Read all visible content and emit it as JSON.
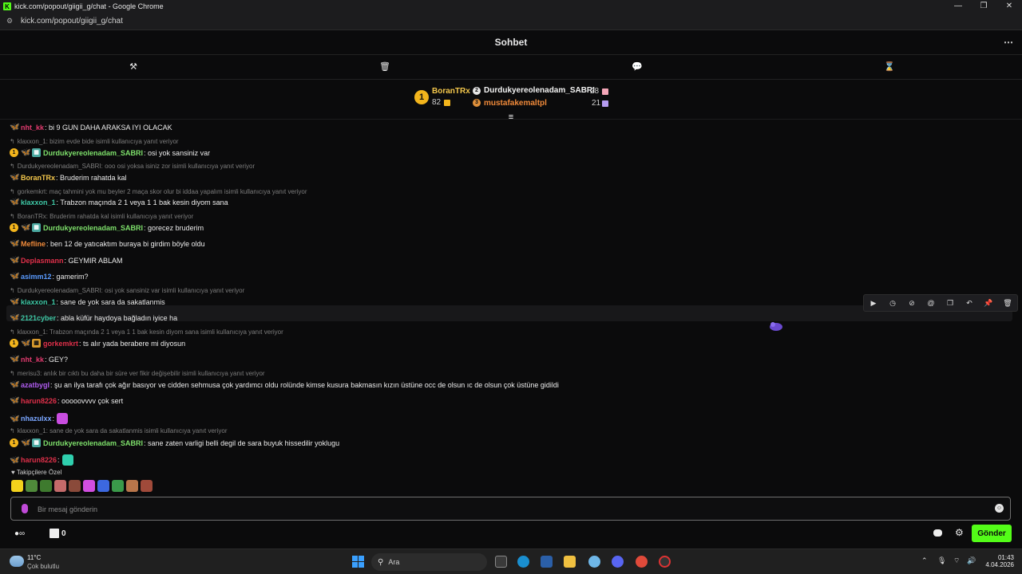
{
  "window": {
    "title": "kick.com/popout/giigii_g/chat - Google Chrome",
    "url": "kick.com/popout/giigii_g/chat",
    "controls": [
      "—",
      "❐",
      "✕"
    ]
  },
  "chat": {
    "title": "Sohbet",
    "more_icon": "⋯"
  },
  "toolbar": {
    "icons": [
      "hammer-icon",
      "trash-icon",
      "chat-bubble-icon",
      "hourglass-icon"
    ]
  },
  "leaderboard": {
    "first": {
      "rank": "1",
      "name": "BoranTRx",
      "count": "82"
    },
    "second": {
      "name": "Durdukyereolenadam_SABRI",
      "count": "28"
    },
    "third": {
      "name": "mustafakemaltpl",
      "count": "21"
    }
  },
  "messages": [
    {
      "type": "msg",
      "user": "nht_kk",
      "color": "#e03a6e",
      "text": ": bi 9 GUN DAHA ARAKSA IYI OLACAK",
      "badges": [
        "fly"
      ]
    },
    {
      "type": "reply",
      "text": "klaxxon_1: bizim evde bide isimli kullanıcıya yanıt veriyor"
    },
    {
      "type": "msg",
      "user": "Durdukyereolenadam_SABRI",
      "color": "#7ee06b",
      "text": ": osi yok sansiniz var",
      "badges": [
        "num",
        "fly",
        "sub"
      ]
    },
    {
      "type": "reply",
      "text": "Durdukyereolenadam_SABRI: ooo osi yoksa isiniz zor isimli kullanıcıya yanıt veriyor"
    },
    {
      "type": "msg",
      "user": "BoranTRx",
      "color": "#f5c84c",
      "text": ": Bruderim rahatda kal",
      "badges": [
        "fly"
      ]
    },
    {
      "type": "reply",
      "text": "gorkemkrt: maç tahmini yok mu beyler 2 maça skor olur bi iddaa yapalım isimli kullanıcıya yanıt veriyor"
    },
    {
      "type": "msg",
      "user": "klaxxon_1",
      "color": "#3ec7a5",
      "text": ": Trabzon maçında 2 1 veya 1 1 bak kesin diyom sana",
      "badges": [
        "fly"
      ]
    },
    {
      "type": "reply",
      "text": "BoranTRx: Bruderim rahatda kal isimli kullanıcıya yanıt veriyor"
    },
    {
      "type": "msg",
      "user": "Durdukyereolenadam_SABRI",
      "color": "#7ee06b",
      "text": ": gorecez bruderim",
      "badges": [
        "num",
        "fly",
        "sub"
      ]
    },
    {
      "type": "msg",
      "user": "Mefline",
      "color": "#f08a3a",
      "text": ": ben 12 de yatıcaktım buraya bi girdim böyle oldu",
      "badges": [
        "fly"
      ]
    },
    {
      "type": "msg",
      "user": "Deplasmann",
      "color": "#e0304a",
      "text": ": GEYMIR ABLAM",
      "badges": [
        "fly"
      ]
    },
    {
      "type": "msg",
      "user": "asimm12",
      "color": "#5a9bff",
      "text": ": gamerim?",
      "badges": [
        "flyy"
      ]
    },
    {
      "type": "reply",
      "text": "Durdukyereolenadam_SABRI: osi yok sansiniz var isimli kullanıcıya yanıt veriyor"
    },
    {
      "type": "msg",
      "user": "klaxxon_1",
      "color": "#3ec7a5",
      "text": ": sane de yok sara da sakatlanmis",
      "badges": [
        "fly"
      ]
    },
    {
      "type": "msg",
      "user": "2121cyber",
      "color": "#3ec7a5",
      "text": ": abla küfür haydoya bağladın iyice ha",
      "badges": [
        "fly"
      ]
    },
    {
      "type": "reply",
      "text": "klaxxon_1: Trabzon maçında 2 1 veya 1 1 bak kesin diyom sana isimli kullanıcıya yanıt veriyor"
    },
    {
      "type": "msg",
      "user": "gorkemkrt",
      "color": "#e0304a",
      "text": ": ts alır yada berabere mi diyosun",
      "badges": [
        "num",
        "fly",
        "gold"
      ]
    },
    {
      "type": "msg",
      "user": "nht_kk",
      "color": "#e03a6e",
      "text": ": GEY?",
      "badges": [
        "fly"
      ]
    },
    {
      "type": "reply",
      "text": "merisu3: anlık bir cıktı bu daha bir süre ver fikir değişebilir isimli kullanıcıya yanıt veriyor"
    },
    {
      "type": "msg",
      "user": "azatbygl",
      "color": "#b05cf0",
      "text": ": şu an ilya tarafı çok ağır basıyor ve cidden sehmusa çok yardımcı oldu rolünde kimse kusura bakmasın kızın üstüne occ de olsun ıc de olsun çok üstüne gidildi",
      "badges": [
        "fly"
      ]
    },
    {
      "type": "msg",
      "user": "harun8226",
      "color": "#e0304a",
      "text": ": ooooovvvv çok sert",
      "badges": [
        "fly"
      ]
    },
    {
      "type": "msg",
      "user": "nhazulxx",
      "color": "#7aa6ff",
      "text": ":",
      "badges": [
        "fly"
      ],
      "emote": "#c94de0"
    },
    {
      "type": "reply",
      "text": "klaxxon_1: sane de yok sara da sakatlanmis isimli kullanıcıya yanıt veriyor"
    },
    {
      "type": "msg",
      "user": "Durdukyereolenadam_SABRI",
      "color": "#7ee06b",
      "text": ": sane zaten varligi belli degil de sara buyuk hissedilir yoklugu",
      "badges": [
        "num",
        "fly",
        "sub"
      ]
    },
    {
      "type": "msg",
      "user": "harun8226",
      "color": "#e0304a",
      "text": ":",
      "badges": [
        "fly"
      ],
      "emote": "#2fcfae"
    }
  ],
  "followers_label": "Takipçilere Özel",
  "input": {
    "placeholder": "Bir mesaj gönderin"
  },
  "bottom": {
    "points": "0",
    "send_label": "Gönder"
  },
  "taskbar": {
    "temp": "11°C",
    "condition": "Çok bulutlu",
    "search_placeholder": "Ara",
    "time": "01:43",
    "date": "4.04.2026"
  },
  "colors": {
    "accent": "#53fc18",
    "background": "#0b0b0c"
  }
}
